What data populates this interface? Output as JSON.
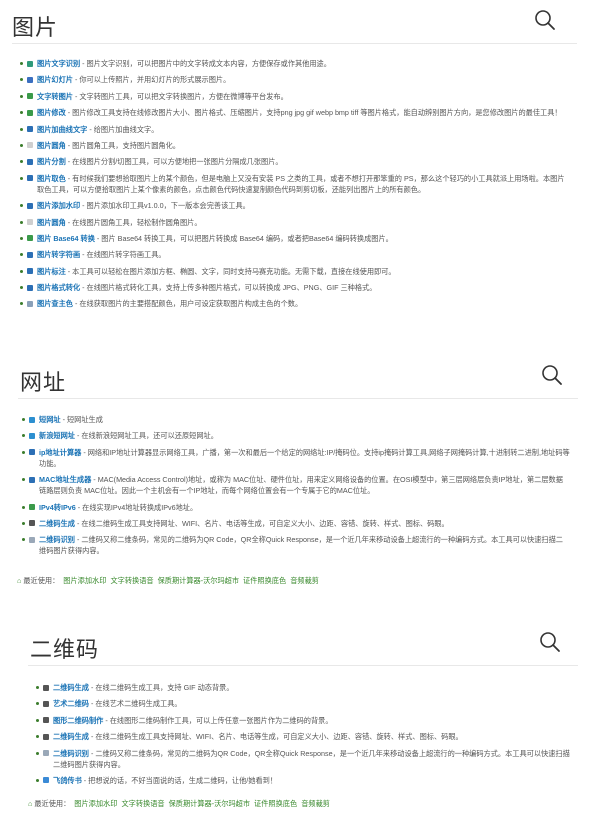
{
  "sections": [
    {
      "title": "图片",
      "items": [
        {
          "name": "图片文字识别",
          "desc": " - 图片文字识别，可以把图片中的文字转成文本内容，方便保存或作其他用途。",
          "icon": "ocr-icon",
          "color": "#2f9a7a"
        },
        {
          "name": "图片幻灯片",
          "desc": " - 你可以上传照片，并用幻灯片的形式展示图片。",
          "icon": "slideshow-icon",
          "color": "#3b6fc0"
        },
        {
          "name": "文字转图片",
          "desc": " - 文字转图片工具，可以把文字转换图片，方便在微博等平台发布。",
          "icon": "text-to-image-icon",
          "color": "#3a9a4a"
        },
        {
          "name": "图片修改",
          "desc": " - 图片修改工具支持在线修改图片大小、图片格式、压缩图片，支持png jpg gif webp bmp tiff 等图片格式，能自动辨别图片方向，是您修改图片的最佳工具！",
          "icon": "image-edit-icon",
          "color": "#3a9a4a"
        },
        {
          "name": "图片加曲线文字",
          "desc": " - 给图片加曲线文字。",
          "icon": "curve-text-icon",
          "color": "#2c6fb5"
        },
        {
          "name": "图片圆角",
          "desc": " - 图片圆角工具，支持图片圆角化。",
          "icon": "round-corner-icon",
          "color": "#cfcfcf"
        },
        {
          "name": "图片分割",
          "desc": " - 在线图片分割/切图工具，可以方便地把一张图片分隔成几张图片。",
          "icon": "image-split-icon",
          "color": "#2c6fb5"
        },
        {
          "name": "图片取色",
          "desc": " - 有时候我们要想拾取图片上的某个颜色，但是电脑上又没有安装 PS 之类的工具，或者不想打开那笨重的 PS，那么这个轻巧的小工具就派上用场啦。本图片取色工具，可以方便拾取图片上某个像素的颜色，点击颜色代码快速复制颜色代码到剪切板，还能列出图片上的所有颜色。",
          "icon": "color-picker-icon",
          "color": "#2c6fb5"
        },
        {
          "name": "图片添加水印",
          "desc": " - 图片添加水印工具v1.0.0，下一版本会完善该工具。",
          "icon": "watermark-icon",
          "color": "#2c6fb5"
        },
        {
          "name": "图片圆角",
          "desc": " - 在线图片圆角工具，轻松制作圆角图片。",
          "icon": "round-corner-icon",
          "color": "#cfcfcf"
        },
        {
          "name": "图片 Base64 转换",
          "desc": " - 图片 Base64 转换工具，可以把图片转换成 Base64 编码，或者把Base64 编码转换成图片。",
          "icon": "base64-icon",
          "color": "#3a9a4a"
        },
        {
          "name": "图片转字符画",
          "desc": " - 在线图片转字符画工具。",
          "icon": "ascii-art-icon",
          "color": "#2c6fb5"
        },
        {
          "name": "图片标注",
          "desc": " - 本工具可以轻松在图片添加方框、椭圆、文字，同时支持马赛克功能。无需下载，直接在线使用即可。",
          "icon": "annotate-icon",
          "color": "#2c6fb5"
        },
        {
          "name": "图片格式转化",
          "desc": " - 在线图片格式转化工具，支持上传多种图片格式，可以转换成 JPG、PNG、GIF 三种格式。",
          "icon": "format-convert-icon",
          "color": "#2c6fb5"
        },
        {
          "name": "图片查主色",
          "desc": " - 在线获取图片的主要搭配颜色，用户可设定获取图片构成主色的个数。",
          "icon": "palette-icon",
          "color": "#8aa0b8"
        }
      ]
    },
    {
      "title": "网址",
      "items": [
        {
          "name": "短网址",
          "desc": " - 短网址生成",
          "icon": "short-url-icon",
          "color": "#2c8fd0"
        },
        {
          "name": "新浪短网址",
          "desc": " - 在线新浪短网址工具，还可以还原短网址。",
          "icon": "sina-url-icon",
          "color": "#2c8fd0"
        },
        {
          "name": "ip地址计算器",
          "desc": " - 网络和IP地址计算器显示网络工具，广播，第一次和最后一个给定的网络址:IP/掩码位。支持ip掩码计算工具,网络子网掩码计算,十进制转二进制,地址码等功能。",
          "icon": "ip-calculator-icon",
          "color": "#2c6fb5"
        },
        {
          "name": "MAC地址生成器",
          "desc": " - MAC(Media Access Control)地址，或称为 MAC位址、硬件位址，用来定义网络设备的位置。在OSI模型中，第三层网络层负责IP地址，第二层数据链路层则负责 MAC位址。因此一个主机会有一个IP地址，而每个网络位置会有一个专属于它的MAC位址。",
          "icon": "mac-address-icon",
          "color": "#2c6fb5"
        },
        {
          "name": "IPv4转IPv6",
          "desc": " - 在线实现IPv4地址转换成IPv6地址。",
          "icon": "ipv6-icon",
          "color": "#3a9a4a"
        },
        {
          "name": "二维码生成",
          "desc": " - 在线二维码生成工具支持网址、WIFI、名片、电话等生成，可自定义大小、边距、容错、旋转、样式、图标、码眼。",
          "icon": "qrcode-icon",
          "color": "#555555"
        },
        {
          "name": "二维码识别",
          "desc": " - 二维码又称二维条码，常见的二维码为QR Code，QR全称Quick Response，是一个近几年来移动设备上超流行的一种编码方式。本工具可以快速扫描二维码图片获得内容。",
          "icon": "qrcode-scan-icon",
          "color": "#9aa8b8"
        }
      ],
      "recent": {
        "label": "最近使用：",
        "links": [
          "图片添加水印",
          "文字转换语音",
          "保质期计算器-沃尔玛超市",
          "证件照换底色",
          "音频裁剪"
        ]
      }
    },
    {
      "title": "二维码",
      "items": [
        {
          "name": "二维码生成",
          "desc": " - 在线二维码生成工具，支持 GIF 动态背景。",
          "icon": "qrcode-icon",
          "color": "#555555"
        },
        {
          "name": "艺术二维码",
          "desc": " - 在线艺术二维码生成工具。",
          "icon": "art-qrcode-icon",
          "color": "#555555"
        },
        {
          "name": "图形二维码制作",
          "desc": " - 在线图形二维码制作工具，可以上传任意一张图片作为二维码的背景。",
          "icon": "graphic-qrcode-icon",
          "color": "#555555"
        },
        {
          "name": "二维码生成",
          "desc": " - 在线二维码生成工具支持网址、WIFI、名片、电话等生成，可自定义大小、边距、容错、旋转、样式、图标、码眼。",
          "icon": "qrcode-icon",
          "color": "#555555"
        },
        {
          "name": "二维码识别",
          "desc": " - 二维码又称二维条码，常见的二维码为QR Code，QR全称Quick Response，是一个近几年来移动设备上超流行的一种编码方式。本工具可以快速扫描二维码图片获得内容。",
          "icon": "qrcode-scan-icon",
          "color": "#9aa8b8"
        },
        {
          "name": "飞鸽传书",
          "desc": " - 把想说的话，不好当面说的话，生成二维码，让他/她看到！",
          "icon": "messenger-icon",
          "color": "#3a8ad6"
        }
      ],
      "recent": {
        "label": "最近使用：",
        "links": [
          "图片添加水印",
          "文字转换语音",
          "保质期计算器-沃尔玛超市",
          "证件照换底色",
          "音频裁剪"
        ]
      }
    }
  ]
}
